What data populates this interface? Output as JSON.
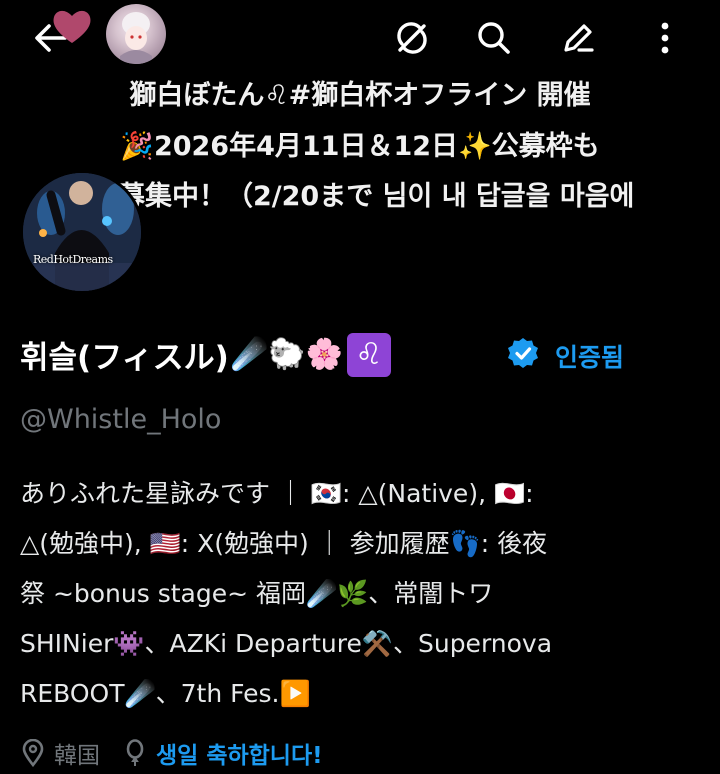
{
  "header": {
    "back_icon": "arrow-left-icon",
    "avatar_label": "profile-avatar",
    "actions": [
      "refresh-off-icon",
      "search-icon",
      "edit-icon",
      "more-vertical-icon"
    ]
  },
  "banner": {
    "line1": "獅白ぼたん♌#獅白杯オフライン 開催",
    "line2": "🎉2026年4月11日＆12日✨公募枠も",
    "line3": "募集中！（2/20まで 님이 내 답글을 마음에"
  },
  "profile": {
    "avatar_tag": "RedHotDreams",
    "display_name": "휘슬(フィスル)",
    "name_emojis": "☄️🐑🌸",
    "zodiac": "♌",
    "verified_label": "인증됨",
    "handle": "@Whistle_Holo"
  },
  "bio": {
    "line1": "ありふれた星詠みです ｜ 🇰🇷: △(Native), 🇯🇵:",
    "line2": "△(勉強中), 🇺🇸: X(勉強中) ｜ 参加履歴👣: 後夜",
    "line3": "祭 ~bonus stage~ 福岡☄️🌿、常闇トワ",
    "line4": "SHINier👾、AZKi Departure⚒️、Supernova",
    "line5": "REBOOT☄️、7th Fes.▶️"
  },
  "meta": {
    "location": "韓国",
    "birthday_link": "생일 축하합니다!"
  },
  "colors": {
    "background": "#000000",
    "accent": "#1d9bf0",
    "muted": "#71767b",
    "zodiac_bg": "#8e44d6"
  }
}
